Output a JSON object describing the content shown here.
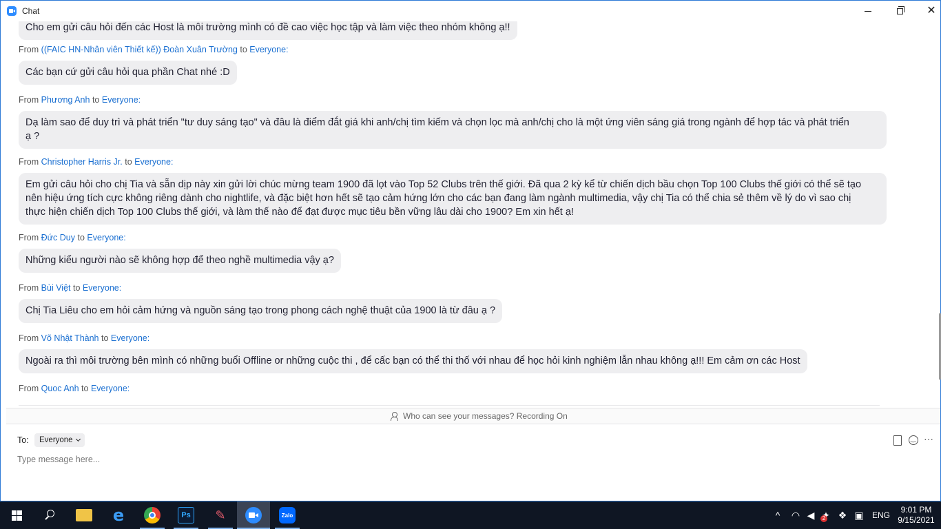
{
  "window": {
    "title": "Chat"
  },
  "messages": [
    {
      "sender": "",
      "recipient": "",
      "text": "Cho em gửi câu hỏi đến các Host  là môi trường mình có đề cao việc học tập và làm việc theo nhóm không ạ!!"
    },
    {
      "sender": "((FAIC HN-Nhân viên Thiết kế)) Đoàn Xuân Trường",
      "recipient": "Everyone:",
      "text": "Các bạn cứ gửi câu hỏi qua phần Chat nhé :D"
    },
    {
      "sender": "Phương Anh",
      "recipient": "Everyone:",
      "lines": [
        "Dạ làm sao để duy trì và phát triển \"tư duy sáng tạo\" và đâu là điểm đắt giá khi anh/chị tìm kiếm và chọn lọc mà anh/chị cho là một ứng viên sáng giá trong ngành để hợp tác và phát triển",
        "ạ ?"
      ]
    },
    {
      "sender": "Christopher Harris Jr.",
      "recipient": "Everyone:",
      "lines": [
        "Em gửi câu hỏi cho chị Tia và sẵn dịp này xin gửi lời chúc mừng team 1900 đã lọt vào Top 52 Clubs trên thế giới. Đã qua 2 kỳ kể từ chiến dịch bầu chọn Top 100 Clubs thế giới có thể sẽ tạo",
        "nên hiệu ứng tích cực không riêng dành cho nightlife, và đặc biệt hơn hết sẽ tạo cảm hứng lớn cho các bạn đang làm ngành multimedia, vậy chị Tia có thể chia sẻ thêm về lý do vì sao chị",
        "thực hiện chiến dịch Top 100 Clubs thế giới, và làm thế nào để đạt được mục tiêu bền vững lâu dài cho 1900? Em xin hết ạ!"
      ]
    },
    {
      "sender": "Đức Duy",
      "recipient": "Everyone:",
      "text": "Những kiểu người nào sẽ không hợp để theo nghề multimedia vậy ạ?"
    },
    {
      "sender": "Bùi Việt",
      "recipient": "Everyone:",
      "text": "Chị Tia Liêu cho em hỏi cảm hứng và nguồn sáng tạo trong phong cách nghệ thuật của 1900 là từ đâu ạ ?"
    },
    {
      "sender": "Võ Nhật Thành",
      "recipient": "Everyone:",
      "text": "Ngoài ra thì môi trường bên mình có những buổi Offline or những cuộc thi , để cấc bạn có thể thi thố với nhau để học hỏi kinh nghiệm lẫn nhau không ạ!!! Em cảm ơn các Host"
    },
    {
      "sender": "Quoc Anh",
      "recipient": "Everyone:"
    }
  ],
  "meta_words": {
    "from": "From",
    "to": "to"
  },
  "privacy_notice": "Who can see your messages? Recording On",
  "composer": {
    "to_label": "To:",
    "to_value": "Everyone",
    "placeholder": "Type message here..."
  },
  "taskbar": {
    "apps": [
      "start-icon",
      "search-icon",
      "file-explorer-icon",
      "edge-icon",
      "chrome-icon",
      "photoshop-icon",
      "paint-icon",
      "zoom-icon",
      "zalo-icon"
    ],
    "ps_label": "Ps",
    "zalo_label": "Zalo",
    "language": "ENG",
    "time": "9:01 PM",
    "date": "9/15/2021",
    "notification_badge": "2"
  }
}
